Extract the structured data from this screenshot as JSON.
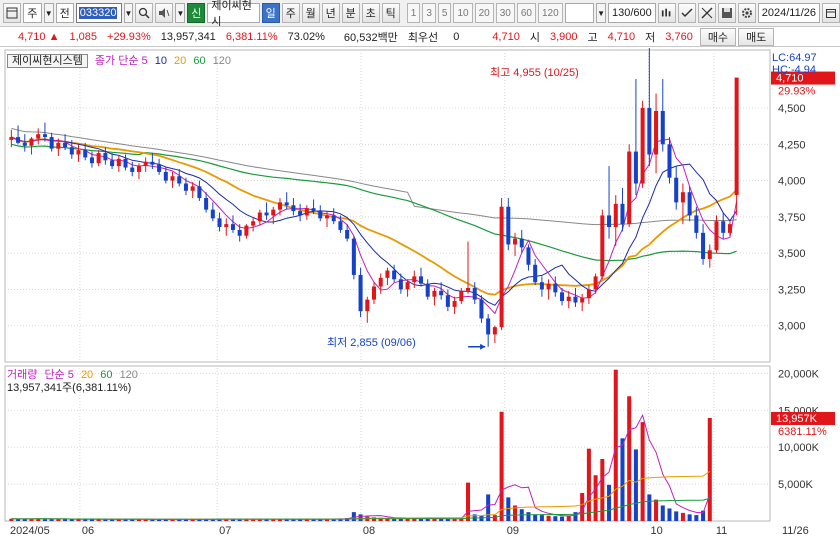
{
  "toolbar": {
    "layout_icon": "layout-grid-icon",
    "period_select": "주",
    "prev_label": "전",
    "stock_code": "033320",
    "search_icon": "magnifier-icon",
    "sound_icon": "speaker-icon",
    "new_badge": "신",
    "stock_name": "제이씨현시",
    "period_tabs": [
      "일",
      "주",
      "월",
      "년",
      "분",
      "초",
      "틱"
    ],
    "active_period": "일",
    "minute_options": [
      "1",
      "3",
      "5",
      "10",
      "20",
      "30",
      "60",
      "120"
    ],
    "range_value": "130/600",
    "tool_icons": [
      "chart-tools-icon",
      "check-icon",
      "draw-icon",
      "save-icon",
      "settings-icon"
    ],
    "date_value": "2024/11/26"
  },
  "quote": {
    "price": "4,710",
    "change": "1,085",
    "change_pct": "+29.93%",
    "volume": "13,957,341",
    "volume_ratio": "6,381.11%",
    "turnover": "73.02%",
    "amount": "60,532백만",
    "bid_label": "최우선",
    "bid_value": "0",
    "ask_value": "4,710",
    "open_label": "시",
    "open_value": "3,900",
    "high_label": "고",
    "high_value": "4,710",
    "low_label": "저",
    "low_value": "3,760",
    "buy_label": "매수",
    "sell_label": "매도"
  },
  "chart_header": {
    "company": "제이씨현시스템",
    "price_legend": "종가 단순",
    "ma_periods": [
      "5",
      "10",
      "20",
      "60",
      "120"
    ],
    "lc": "LC:64.97",
    "hc": "HC:-4.94",
    "high_marker": "최고 4,955 (10/25)",
    "low_marker": "최저 2,855 (09/06)"
  },
  "volume_header": {
    "title": "거래량",
    "legend": "단순",
    "ma_periods": [
      "5",
      "20",
      "60",
      "120"
    ],
    "value_line": "13,957,341주(6,381.11%)"
  },
  "colors": {
    "up": "#e0161b",
    "down": "#1642c8",
    "ma5": "#c020c0",
    "ma10": "#1c2aa8",
    "ma20": "#e89a00",
    "ma60": "#1a9a3a",
    "ma120": "#888888"
  },
  "chart_data": [
    {
      "type": "candlestick",
      "title": "제이씨현시스템",
      "y_ticks": [
        "4,710",
        "29.93%",
        "4,500",
        "4,250",
        "4,000",
        "3,750",
        "3,500",
        "3,250",
        "3,000"
      ],
      "ylim": [
        2750,
        4900
      ],
      "x_ticks": [
        "2024/05",
        "06",
        "07",
        "08",
        "09",
        "10",
        "11",
        "11/26"
      ],
      "last": {
        "open": 3900,
        "high": 4710,
        "low": 3760,
        "close": 4710
      },
      "candles": [
        [
          4280,
          4350,
          4230,
          4300
        ],
        [
          4300,
          4380,
          4250,
          4260
        ],
        [
          4260,
          4320,
          4200,
          4240
        ],
        [
          4240,
          4300,
          4180,
          4290
        ],
        [
          4290,
          4360,
          4250,
          4320
        ],
        [
          4320,
          4400,
          4270,
          4300
        ],
        [
          4300,
          4330,
          4200,
          4220
        ],
        [
          4220,
          4290,
          4170,
          4260
        ],
        [
          4260,
          4320,
          4210,
          4230
        ],
        [
          4230,
          4280,
          4150,
          4180
        ],
        [
          4180,
          4250,
          4130,
          4210
        ],
        [
          4210,
          4260,
          4140,
          4160
        ],
        [
          4160,
          4200,
          4090,
          4120
        ],
        [
          4120,
          4210,
          4100,
          4190
        ],
        [
          4190,
          4230,
          4110,
          4140
        ],
        [
          4140,
          4190,
          4080,
          4100
        ],
        [
          4100,
          4170,
          4060,
          4150
        ],
        [
          4150,
          4180,
          4070,
          4090
        ],
        [
          4090,
          4130,
          4030,
          4060
        ],
        [
          4060,
          4120,
          4010,
          4100
        ],
        [
          4100,
          4160,
          4060,
          4130
        ],
        [
          4130,
          4190,
          4080,
          4110
        ],
        [
          4110,
          4150,
          4040,
          4060
        ],
        [
          4060,
          4090,
          3980,
          4000
        ],
        [
          4000,
          4060,
          3950,
          4030
        ],
        [
          4030,
          4080,
          3960,
          3980
        ],
        [
          3980,
          4020,
          3900,
          3930
        ],
        [
          3930,
          3990,
          3880,
          3960
        ],
        [
          3960,
          4000,
          3860,
          3880
        ],
        [
          3880,
          3920,
          3780,
          3800
        ],
        [
          3800,
          3850,
          3720,
          3740
        ],
        [
          3740,
          3780,
          3650,
          3680
        ],
        [
          3680,
          3740,
          3620,
          3700
        ],
        [
          3700,
          3760,
          3640,
          3660
        ],
        [
          3660,
          3700,
          3580,
          3620
        ],
        [
          3620,
          3700,
          3600,
          3690
        ],
        [
          3690,
          3750,
          3650,
          3720
        ],
        [
          3720,
          3800,
          3690,
          3780
        ],
        [
          3780,
          3850,
          3730,
          3760
        ],
        [
          3760,
          3820,
          3700,
          3800
        ],
        [
          3800,
          3880,
          3760,
          3850
        ],
        [
          3850,
          3920,
          3800,
          3830
        ],
        [
          3830,
          3880,
          3760,
          3790
        ],
        [
          3790,
          3840,
          3720,
          3760
        ],
        [
          3760,
          3830,
          3730,
          3810
        ],
        [
          3810,
          3870,
          3770,
          3790
        ],
        [
          3790,
          3830,
          3720,
          3740
        ],
        [
          3740,
          3790,
          3680,
          3760
        ],
        [
          3760,
          3810,
          3700,
          3720
        ],
        [
          3720,
          3760,
          3640,
          3660
        ],
        [
          3660,
          3700,
          3580,
          3600
        ],
        [
          3600,
          3620,
          3320,
          3350
        ],
        [
          3350,
          3400,
          3060,
          3100
        ],
        [
          3100,
          3200,
          3020,
          3180
        ],
        [
          3180,
          3300,
          3150,
          3270
        ],
        [
          3270,
          3360,
          3220,
          3330
        ],
        [
          3330,
          3400,
          3280,
          3380
        ],
        [
          3380,
          3420,
          3300,
          3320
        ],
        [
          3320,
          3360,
          3220,
          3250
        ],
        [
          3250,
          3320,
          3200,
          3300
        ],
        [
          3300,
          3380,
          3260,
          3340
        ],
        [
          3340,
          3400,
          3270,
          3290
        ],
        [
          3290,
          3320,
          3180,
          3200
        ],
        [
          3200,
          3260,
          3140,
          3240
        ],
        [
          3240,
          3300,
          3180,
          3210
        ],
        [
          3210,
          3250,
          3100,
          3130
        ],
        [
          3130,
          3200,
          3080,
          3170
        ],
        [
          3170,
          3260,
          3150,
          3240
        ],
        [
          3240,
          3580,
          3220,
          3260
        ],
        [
          3260,
          3300,
          3150,
          3180
        ],
        [
          3180,
          3210,
          3020,
          3050
        ],
        [
          3050,
          3080,
          2855,
          2940
        ],
        [
          2940,
          3000,
          2880,
          2990
        ],
        [
          2990,
          3880,
          2970,
          3820
        ],
        [
          3820,
          3880,
          3520,
          3560
        ],
        [
          3560,
          3640,
          3480,
          3600
        ],
        [
          3600,
          3660,
          3500,
          3540
        ],
        [
          3540,
          3560,
          3380,
          3420
        ],
        [
          3420,
          3460,
          3280,
          3300
        ],
        [
          3300,
          3340,
          3200,
          3250
        ],
        [
          3250,
          3320,
          3180,
          3290
        ],
        [
          3290,
          3340,
          3200,
          3230
        ],
        [
          3230,
          3260,
          3140,
          3170
        ],
        [
          3170,
          3240,
          3120,
          3200
        ],
        [
          3200,
          3260,
          3130,
          3160
        ],
        [
          3160,
          3220,
          3100,
          3190
        ],
        [
          3190,
          3280,
          3150,
          3250
        ],
        [
          3250,
          3360,
          3220,
          3340
        ],
        [
          3340,
          3800,
          3320,
          3760
        ],
        [
          3760,
          4100,
          3600,
          3680
        ],
        [
          3680,
          3900,
          3550,
          3840
        ],
        [
          3840,
          3950,
          3650,
          3700
        ],
        [
          3700,
          4250,
          3680,
          4200
        ],
        [
          4200,
          4700,
          3900,
          3980
        ],
        [
          3980,
          4550,
          3950,
          4500
        ],
        [
          4500,
          4955,
          4100,
          4180
        ],
        [
          4180,
          4600,
          4050,
          4480
        ],
        [
          4480,
          4700,
          4200,
          4250
        ],
        [
          4250,
          4300,
          3980,
          4020
        ],
        [
          4020,
          4100,
          3800,
          3850
        ],
        [
          3850,
          3980,
          3700,
          3920
        ],
        [
          3920,
          3960,
          3720,
          3760
        ],
        [
          3760,
          3820,
          3600,
          3640
        ],
        [
          3640,
          3700,
          3420,
          3460
        ],
        [
          3460,
          3560,
          3400,
          3520
        ],
        [
          3520,
          3760,
          3500,
          3720
        ],
        [
          3720,
          3780,
          3600,
          3640
        ],
        [
          3640,
          3720,
          3620,
          3700
        ],
        [
          3900,
          4710,
          3760,
          4710
        ]
      ]
    },
    {
      "type": "bar",
      "title": "거래량",
      "y_ticks": [
        "20,000K",
        "15,000K",
        "13,957K",
        "6381.11%",
        "10,000K",
        "5,000K"
      ],
      "ylim": [
        0,
        21000
      ],
      "volumes_k": [
        300,
        280,
        260,
        300,
        320,
        290,
        270,
        250,
        260,
        240,
        230,
        220,
        250,
        240,
        230,
        210,
        220,
        240,
        230,
        220,
        210,
        230,
        240,
        260,
        250,
        240,
        230,
        220,
        250,
        260,
        280,
        300,
        270,
        260,
        250,
        240,
        260,
        280,
        270,
        250,
        240,
        230,
        220,
        240,
        250,
        260,
        270,
        280,
        290,
        310,
        400,
        1200,
        900,
        600,
        500,
        450,
        400,
        380,
        420,
        390,
        360,
        340,
        330,
        320,
        310,
        300,
        330,
        340,
        5200,
        900,
        700,
        3600,
        800,
        14800,
        3200,
        2100,
        1600,
        1200,
        900,
        800,
        700,
        650,
        600,
        700,
        1200,
        3800,
        9800,
        6200,
        8400,
        4900,
        20500,
        11200,
        16900,
        9700,
        13400,
        3600,
        2900,
        2100,
        1700,
        1300,
        1100,
        900,
        800,
        1400,
        13957
      ]
    }
  ]
}
